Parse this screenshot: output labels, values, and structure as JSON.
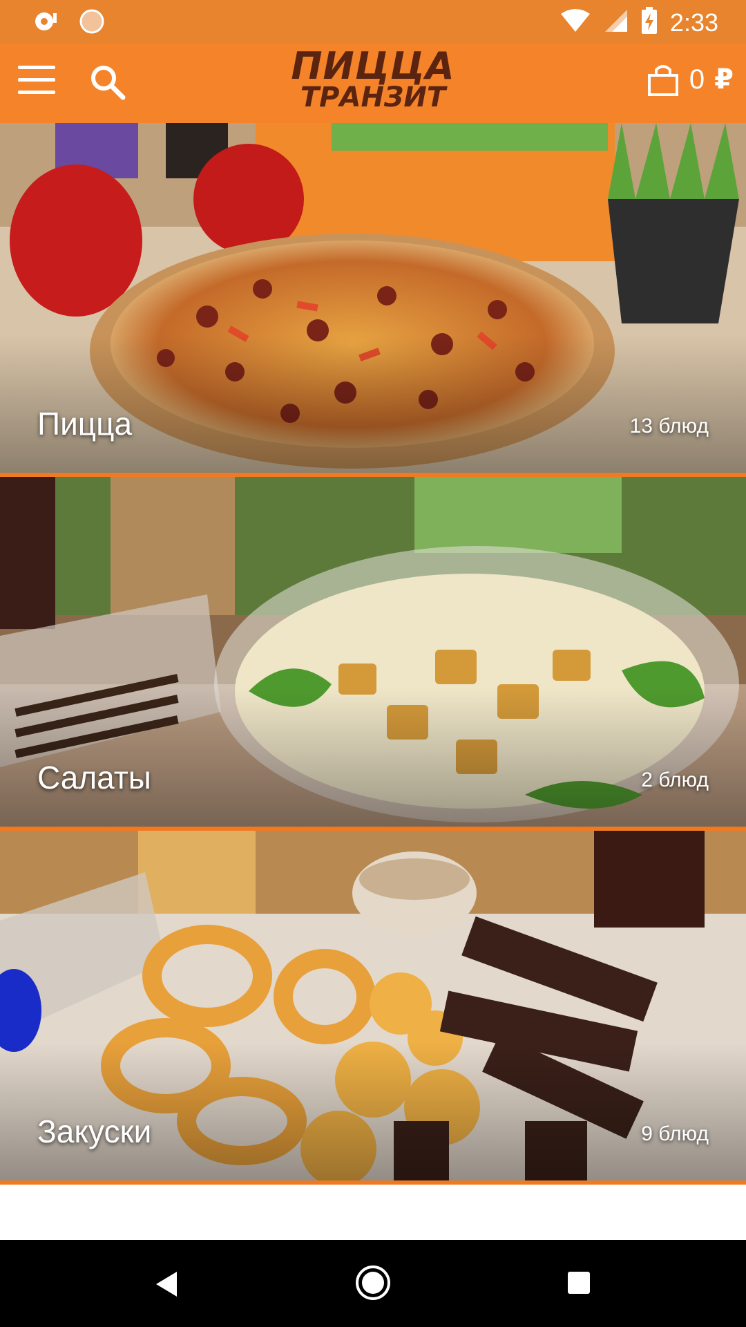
{
  "status_bar": {
    "time": "2:33",
    "icons": [
      "notification-icon",
      "notification-icon-2",
      "wifi-icon",
      "signal-icon",
      "battery-charging-icon"
    ]
  },
  "app_bar": {
    "logo_line1": "ПИЦЦА",
    "logo_line2": "ТРАНЗИТ",
    "cart_amount": "0",
    "cart_currency": "₽",
    "colors": {
      "app_bar": "#f5832a",
      "status_bar": "#e8832e",
      "logo": "#5a2410"
    }
  },
  "categories": [
    {
      "name": "Пицца",
      "count": "13 блюд",
      "icon": "pizza-photo"
    },
    {
      "name": "Салаты",
      "count": "2 блюд",
      "icon": "salad-photo"
    },
    {
      "name": "Закуски",
      "count": "9 блюд",
      "icon": "snacks-photo"
    }
  ],
  "nav_bar": {
    "icons": [
      "back-icon",
      "home-icon",
      "recent-apps-icon"
    ]
  }
}
